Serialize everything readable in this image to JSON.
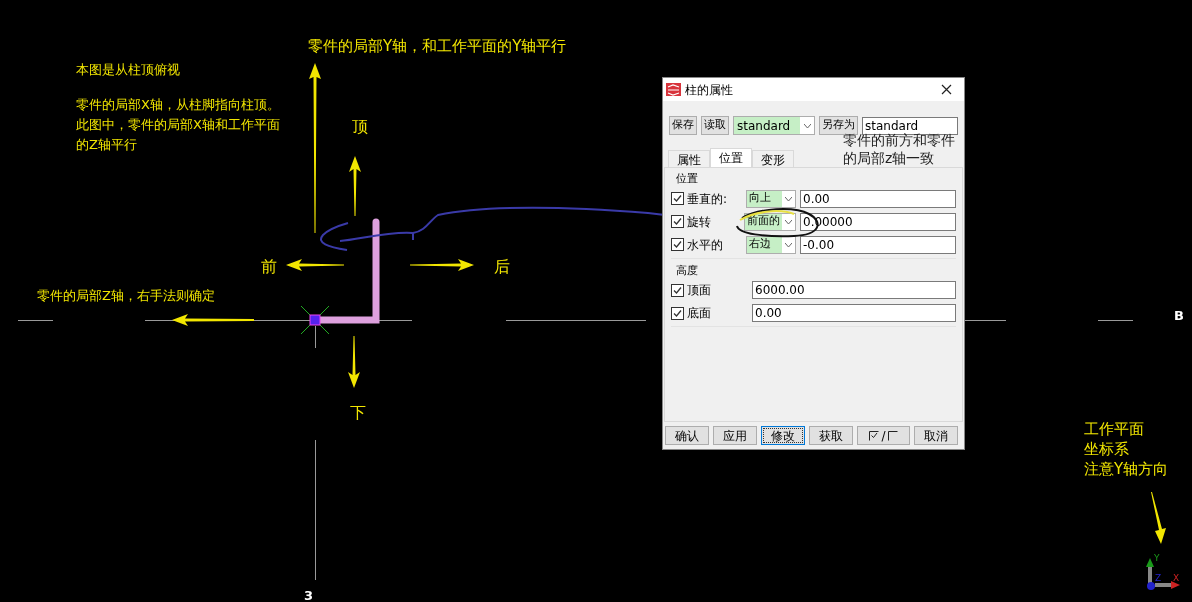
{
  "canvas": {
    "y_axis_note": "零件的局部Y轴，和工作平面的Y轴平行",
    "view_note": "本图是从柱顶俯视",
    "x_axis_note": [
      "零件的局部X轴，从柱脚指向柱顶。",
      "此图中，零件的局部X轴和工作平面",
      "的Z轴平行"
    ],
    "z_axis_note": "零件的局部Z轴，右手法则确定",
    "directions": [
      {
        "kind": "top",
        "label": "顶"
      },
      {
        "kind": "front",
        "label": "前"
      },
      {
        "kind": "back",
        "label": "后"
      },
      {
        "kind": "bottom",
        "label": "下"
      }
    ],
    "grid_labels": [
      {
        "kind": "row",
        "label": "B"
      },
      {
        "kind": "column",
        "label": "3"
      }
    ],
    "workplane_note": [
      "工作平面",
      "坐标系",
      "注意Y轴方向"
    ],
    "workplane_axes": {
      "y": "Y",
      "z": "Z",
      "x": "X"
    }
  },
  "dialog": {
    "title": "柱的属性",
    "toolbar": {
      "save": "保存",
      "load": "读取",
      "preset": "standard",
      "save_as": "另存为",
      "save_as_name": "standard"
    },
    "tabs": [
      {
        "label": "属性",
        "selected": false
      },
      {
        "label": "位置",
        "selected": true
      },
      {
        "label": "变形",
        "selected": false
      }
    ],
    "annotation": [
      "零件的前方和零件",
      "的局部z轴一致"
    ],
    "groups": [
      {
        "title": "位置",
        "rows": [
          {
            "kind": "dropdown",
            "label": "垂直的:",
            "checked": true,
            "option": "向上",
            "value": "0.00"
          },
          {
            "kind": "dropdown",
            "label": "旋转",
            "checked": true,
            "option": "前面的",
            "value": "0.00000"
          },
          {
            "kind": "dropdown",
            "label": "水平的",
            "checked": true,
            "option": "右边",
            "value": "-0.00"
          }
        ]
      },
      {
        "title": "高度",
        "rows": [
          {
            "kind": "plain",
            "label": "顶面",
            "checked": true,
            "value": "6000.00"
          },
          {
            "kind": "plain",
            "label": "底面",
            "checked": true,
            "value": "0.00"
          }
        ]
      }
    ],
    "buttons": [
      {
        "kind": "text",
        "label": "确认",
        "focused": false
      },
      {
        "kind": "text",
        "label": "应用",
        "focused": false
      },
      {
        "kind": "text",
        "label": "修改",
        "focused": true
      },
      {
        "kind": "text",
        "label": "获取",
        "focused": false
      },
      {
        "kind": "toggle",
        "label": "/",
        "focused": false
      },
      {
        "kind": "text",
        "label": "取消",
        "focused": false
      }
    ]
  }
}
